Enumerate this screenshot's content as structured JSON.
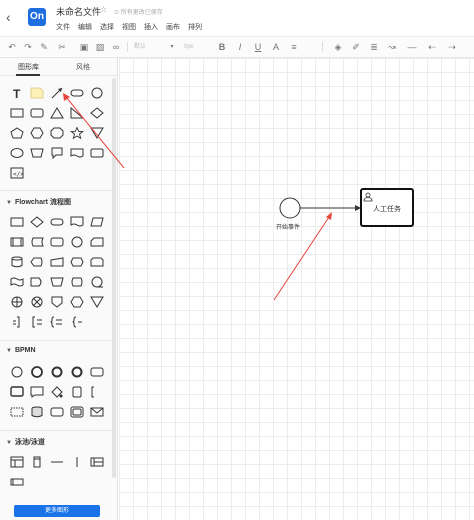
{
  "header": {
    "title": "未命名文件",
    "save_status": "所有更改已保存",
    "logo_text": "On",
    "menu": [
      "文件",
      "编辑",
      "选择",
      "视图",
      "插入",
      "画布",
      "排列"
    ]
  },
  "toolbar": {
    "style_select": "默认",
    "size_select": "0px",
    "icons": [
      "undo-icon",
      "redo-icon",
      "format-brush-icon",
      "clear-format-icon",
      "image-icon",
      "picture-icon",
      "link-icon",
      "font-family-select",
      "font-size-select",
      "bold-icon",
      "italic-icon",
      "underline-icon",
      "font-color-icon",
      "align-icon",
      "fill-color-icon",
      "line-color-icon",
      "line-style-icon",
      "connector-icon",
      "arrow-end-icon"
    ]
  },
  "panel": {
    "tabs": [
      "图形库",
      "风格"
    ],
    "sections": [
      {
        "title": "Flowchart 流程图"
      },
      {
        "title": "BPMN"
      },
      {
        "title": "泳池/泳道"
      }
    ],
    "more_button": "更多图形"
  },
  "canvas": {
    "start_event_label": "开始事件",
    "task_label": "人工任务"
  },
  "colors": {
    "accent": "#1a73e8",
    "annotation_arrow": "#e8453c"
  }
}
